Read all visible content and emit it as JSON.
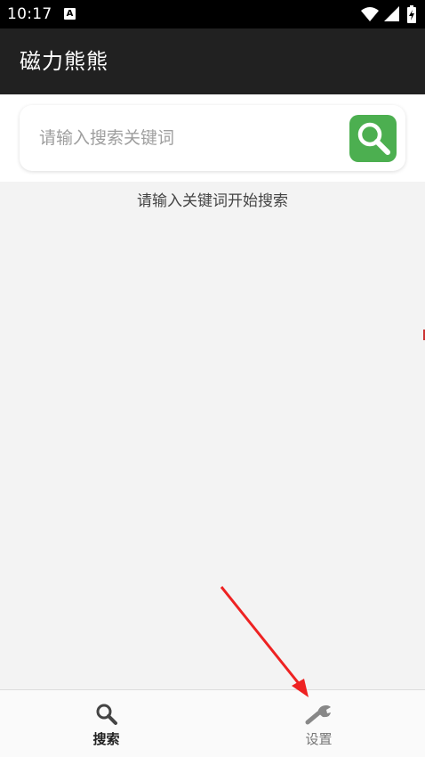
{
  "status_bar": {
    "time": "10:17",
    "notification_icon_letter": "A",
    "icons": [
      "wifi-icon",
      "signal-icon",
      "battery-charging-icon"
    ]
  },
  "app_bar": {
    "title": "磁力熊熊"
  },
  "search": {
    "placeholder": "请输入搜索关键词",
    "value": "",
    "button_icon": "search-icon",
    "button_color": "#4caf50"
  },
  "content": {
    "hint": "请输入关键词开始搜索"
  },
  "bottom_nav": {
    "items": [
      {
        "label": "搜索",
        "icon": "search-icon",
        "active": true
      },
      {
        "label": "设置",
        "icon": "wrench-icon",
        "active": false
      }
    ]
  },
  "annotation": {
    "arrow_color": "#ee2222"
  }
}
